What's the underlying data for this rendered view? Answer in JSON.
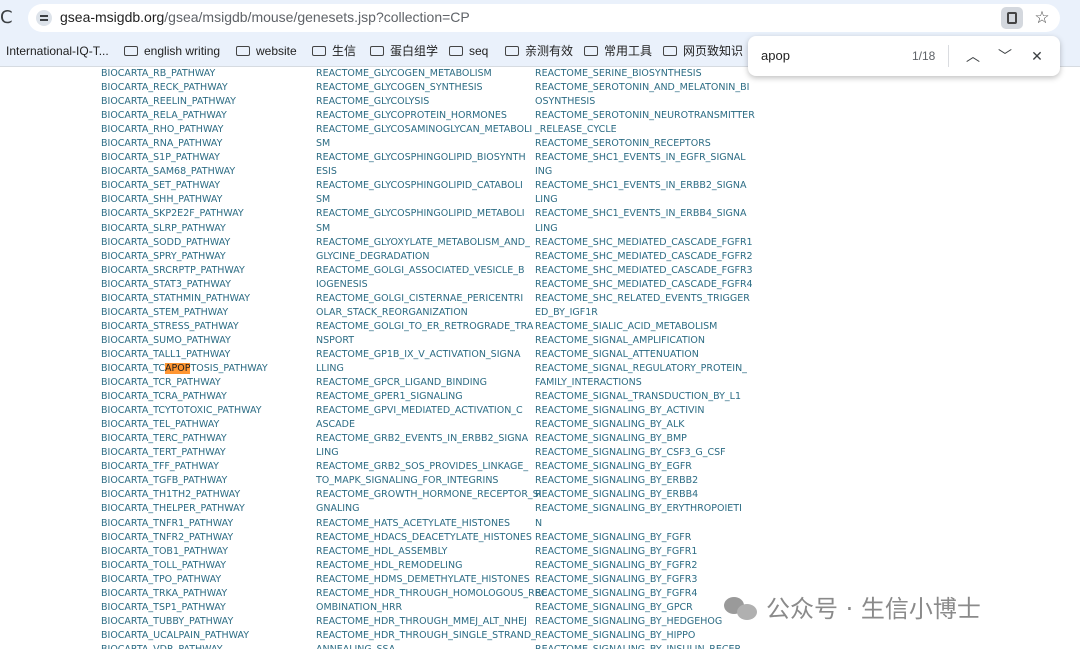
{
  "browser": {
    "url_host": "gsea-msigdb.org",
    "url_path": "/gsea/msigdb/mouse/genesets.jsp?collection=CP",
    "reload_glyph": "C"
  },
  "bookmarks": [
    {
      "label": "International-IQ-T...",
      "icon": "bookmark-icon"
    },
    {
      "label": "english writing",
      "icon": "folder-icon"
    },
    {
      "label": "website",
      "icon": "folder-icon"
    },
    {
      "label": "生信",
      "icon": "folder-icon"
    },
    {
      "label": "蛋白组学",
      "icon": "folder-icon"
    },
    {
      "label": "seq",
      "icon": "folder-icon"
    },
    {
      "label": "亲测有效",
      "icon": "folder-icon"
    },
    {
      "label": "常用工具",
      "icon": "folder-icon"
    },
    {
      "label": "网页致知识",
      "icon": "folder-icon"
    }
  ],
  "find_bar": {
    "query": "apop",
    "count": "1/18"
  },
  "highlight": {
    "before": "BIOCARTA_TC",
    "match": "APOP",
    "after": "TOSIS_PATHWAY"
  },
  "col1": [
    "BIOCARTA_RB_PATHWAY",
    "BIOCARTA_RECK_PATHWAY",
    "BIOCARTA_REELIN_PATHWAY",
    "BIOCARTA_RELA_PATHWAY",
    "BIOCARTA_RHO_PATHWAY",
    "BIOCARTA_RNA_PATHWAY",
    "BIOCARTA_S1P_PATHWAY",
    "BIOCARTA_SAM68_PATHWAY",
    "BIOCARTA_SET_PATHWAY",
    "BIOCARTA_SHH_PATHWAY",
    "BIOCARTA_SKP2E2F_PATHWAY",
    "BIOCARTA_SLRP_PATHWAY",
    "BIOCARTA_SODD_PATHWAY",
    "BIOCARTA_SPRY_PATHWAY",
    "BIOCARTA_SRCRPTP_PATHWAY",
    "BIOCARTA_STAT3_PATHWAY",
    "BIOCARTA_STATHMIN_PATHWAY",
    "BIOCARTA_STEM_PATHWAY",
    "BIOCARTA_STRESS_PATHWAY",
    "BIOCARTA_SUMO_PATHWAY",
    "BIOCARTA_TALL1_PATHWAY",
    "",
    "BIOCARTA_TCR_PATHWAY",
    "BIOCARTA_TCRA_PATHWAY",
    "BIOCARTA_TCYTOTOXIC_PATHWAY",
    "BIOCARTA_TEL_PATHWAY",
    "BIOCARTA_TERC_PATHWAY",
    "BIOCARTA_TERT_PATHWAY",
    "BIOCARTA_TFF_PATHWAY",
    "BIOCARTA_TGFB_PATHWAY",
    "BIOCARTA_TH1TH2_PATHWAY",
    "BIOCARTA_THELPER_PATHWAY",
    "BIOCARTA_TNFR1_PATHWAY",
    "BIOCARTA_TNFR2_PATHWAY",
    "BIOCARTA_TOB1_PATHWAY",
    "BIOCARTA_TOLL_PATHWAY",
    "BIOCARTA_TPO_PATHWAY",
    "BIOCARTA_TRKA_PATHWAY",
    "BIOCARTA_TSP1_PATHWAY",
    "BIOCARTA_TUBBY_PATHWAY",
    "BIOCARTA_UCALPAIN_PATHWAY",
    "BIOCARTA_VDR_PATHWAY"
  ],
  "col2": [
    "REACTOME_GLYCOGEN_METABOLISM",
    "REACTOME_GLYCOGEN_SYNTHESIS",
    "REACTOME_GLYCOLYSIS",
    "REACTOME_GLYCOPROTEIN_HORMONES",
    "REACTOME_GLYCOSAMINOGLYCAN_METABOLI",
    "SM",
    "REACTOME_GLYCOSPHINGOLIPID_BIOSYNTH",
    "ESIS",
    "REACTOME_GLYCOSPHINGOLIPID_CATABOLI",
    "SM",
    "REACTOME_GLYCOSPHINGOLIPID_METABOLI",
    "SM",
    "REACTOME_GLYOXYLATE_METABOLISM_AND_",
    "GLYCINE_DEGRADATION",
    "REACTOME_GOLGI_ASSOCIATED_VESICLE_B",
    "IOGENESIS",
    "REACTOME_GOLGI_CISTERNAE_PERICENTRI",
    "OLAR_STACK_REORGANIZATION",
    "REACTOME_GOLGI_TO_ER_RETROGRADE_TRA",
    "NSPORT",
    "REACTOME_GP1B_IX_V_ACTIVATION_SIGNA",
    "LLING",
    "REACTOME_GPCR_LIGAND_BINDING",
    "REACTOME_GPER1_SIGNALING",
    "REACTOME_GPVI_MEDIATED_ACTIVATION_C",
    "ASCADE",
    "REACTOME_GRB2_EVENTS_IN_ERBB2_SIGNA",
    "LING",
    "REACTOME_GRB2_SOS_PROVIDES_LINKAGE_",
    "TO_MAPK_SIGNALING_FOR_INTEGRINS",
    "REACTOME_GROWTH_HORMONE_RECEPTOR_SI",
    "GNALING",
    "REACTOME_HATS_ACETYLATE_HISTONES",
    "REACTOME_HDACS_DEACETYLATE_HISTONES",
    "REACTOME_HDL_ASSEMBLY",
    "REACTOME_HDL_REMODELING",
    "REACTOME_HDMS_DEMETHYLATE_HISTONES",
    "REACTOME_HDR_THROUGH_HOMOLOGOUS_REC",
    "OMBINATION_HRR",
    "REACTOME_HDR_THROUGH_MMEJ_ALT_NHEJ",
    "REACTOME_HDR_THROUGH_SINGLE_STRAND_",
    "ANNEALING_SSA"
  ],
  "col3": [
    "REACTOME_SERINE_BIOSYNTHESIS",
    "REACTOME_SEROTONIN_AND_MELATONIN_BI",
    "OSYNTHESIS",
    "REACTOME_SEROTONIN_NEUROTRANSMITTER",
    "_RELEASE_CYCLE",
    "REACTOME_SEROTONIN_RECEPTORS",
    "REACTOME_SHC1_EVENTS_IN_EGFR_SIGNAL",
    "ING",
    "REACTOME_SHC1_EVENTS_IN_ERBB2_SIGNA",
    "LING",
    "REACTOME_SHC1_EVENTS_IN_ERBB4_SIGNA",
    "LING",
    "REACTOME_SHC_MEDIATED_CASCADE_FGFR1",
    "REACTOME_SHC_MEDIATED_CASCADE_FGFR2",
    "REACTOME_SHC_MEDIATED_CASCADE_FGFR3",
    "REACTOME_SHC_MEDIATED_CASCADE_FGFR4",
    "REACTOME_SHC_RELATED_EVENTS_TRIGGER",
    "ED_BY_IGF1R",
    "REACTOME_SIALIC_ACID_METABOLISM",
    "REACTOME_SIGNAL_AMPLIFICATION",
    "REACTOME_SIGNAL_ATTENUATION",
    "REACTOME_SIGNAL_REGULATORY_PROTEIN_",
    "FAMILY_INTERACTIONS",
    "REACTOME_SIGNAL_TRANSDUCTION_BY_L1",
    "REACTOME_SIGNALING_BY_ACTIVIN",
    "REACTOME_SIGNALING_BY_ALK",
    "REACTOME_SIGNALING_BY_BMP",
    "REACTOME_SIGNALING_BY_CSF3_G_CSF",
    "REACTOME_SIGNALING_BY_EGFR",
    "REACTOME_SIGNALING_BY_ERBB2",
    "REACTOME_SIGNALING_BY_ERBB4",
    "REACTOME_SIGNALING_BY_ERYTHROPOIETI",
    "N",
    "REACTOME_SIGNALING_BY_FGFR",
    "REACTOME_SIGNALING_BY_FGFR1",
    "REACTOME_SIGNALING_BY_FGFR2",
    "REACTOME_SIGNALING_BY_FGFR3",
    "REACTOME_SIGNALING_BY_FGFR4",
    "REACTOME_SIGNALING_BY_GPCR",
    "REACTOME_SIGNALING_BY_HEDGEHOG",
    "REACTOME_SIGNALING_BY_HIPPO",
    "REACTOME_SIGNALING_BY_INSULIN_RECEP"
  ],
  "watermark": "公众号 · 生信小博士"
}
